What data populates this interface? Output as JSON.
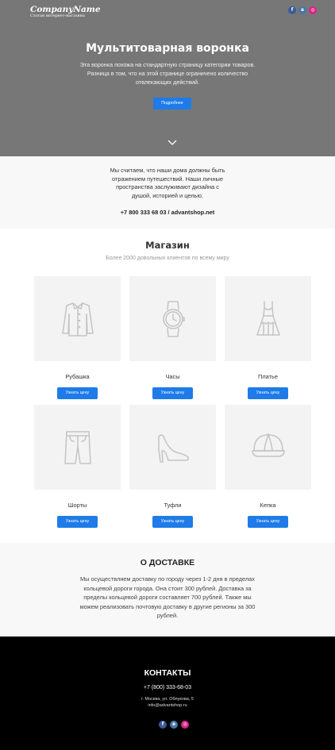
{
  "header": {
    "logo_name": "CompanyName",
    "logo_tagline": "Слоган интернет-магазина",
    "socials": [
      "f",
      "vk",
      "ig"
    ]
  },
  "hero": {
    "title": "Мультитоварная воронка",
    "description": "Эта воронка похожа на стандартную страницу категории товаров. Разница в том, что на этой странице ограничено количество отвлекающих действий.",
    "button": "Подробнее"
  },
  "about": {
    "text": "Мы считаем, что наши дома должны быть отражением путешествий. Наши личные пространства заслуживают дизайна с душой, историей и целью.",
    "contact": "+7 800 333 68 03 / advantshop.net"
  },
  "shop": {
    "title": "Магазин",
    "subtitle": "Более 2000 довольных клиентов по всему миру",
    "button_label": "Узнать цену",
    "products": [
      {
        "name": "Рубашка",
        "icon": "shirt-icon"
      },
      {
        "name": "Часы",
        "icon": "watch-icon"
      },
      {
        "name": "Платье",
        "icon": "dress-icon"
      },
      {
        "name": "Шорты",
        "icon": "shorts-icon"
      },
      {
        "name": "Туфли",
        "icon": "heel-shoe-icon"
      },
      {
        "name": "Кепка",
        "icon": "cap-icon"
      }
    ]
  },
  "delivery": {
    "title": "О ДОСТАВКЕ",
    "text": "Мы осуществляем доставку по городу через 1-2 дня в пределах кольцевой дороги города. Она стоит 300 рублей. Доставка за пределы кольцевой дороги составляет 700 рублей. Также мы можем реализовать почтовую доставку в другие регионы за 300 рублей."
  },
  "contacts": {
    "title": "КОНТАКТЫ",
    "phone": "+7 (800) 333-68-03",
    "address": "г. Москва, ул. Облукова, 5",
    "email": "info@advantshop.ru"
  },
  "colors": {
    "accent": "#1e7be8",
    "hero_bg": "#777777",
    "footer_bg": "#000000",
    "facebook": "#3b5998",
    "vk": "#4a76a8",
    "instagram": "#d8238a"
  }
}
